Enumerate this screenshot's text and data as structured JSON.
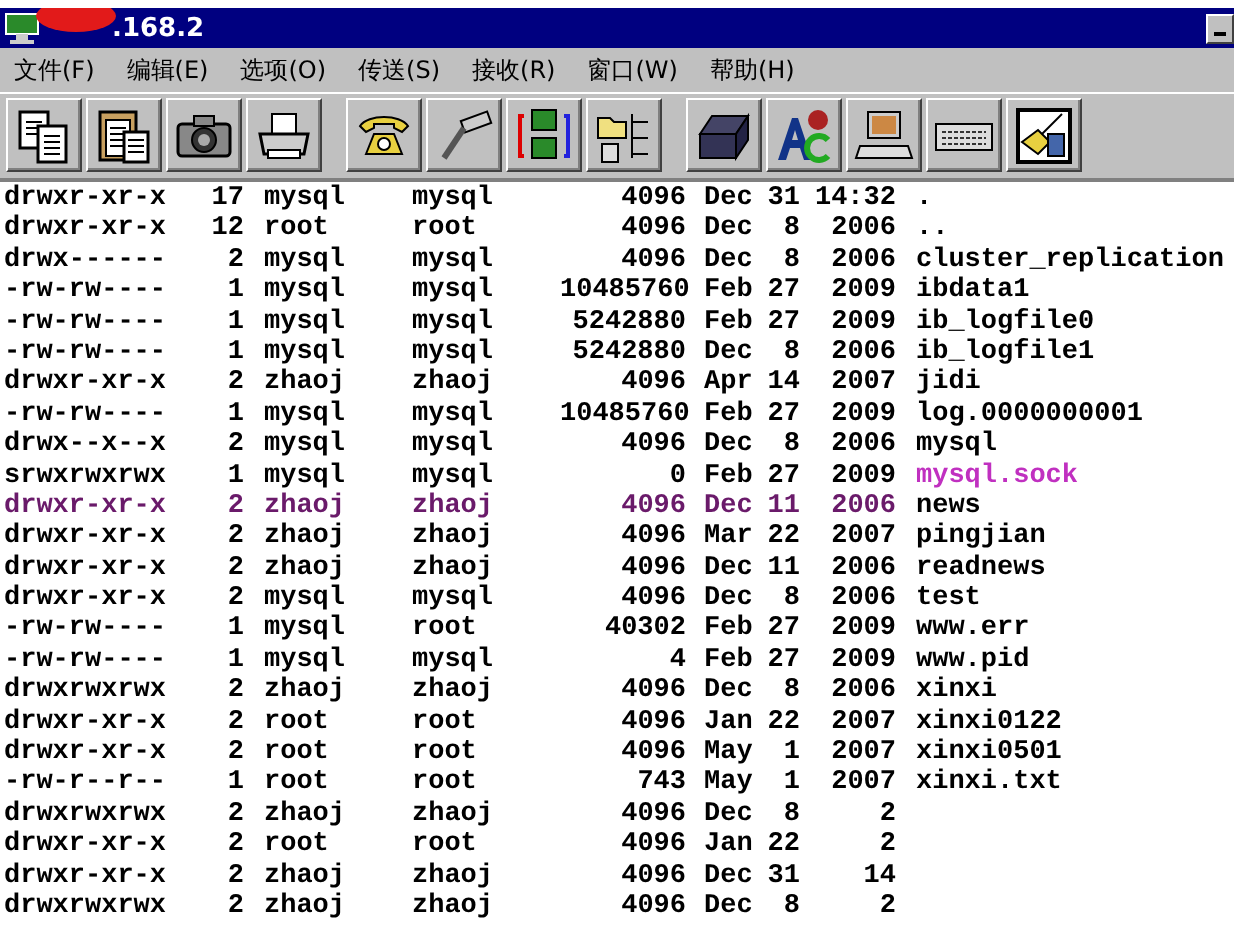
{
  "window": {
    "title": ".168.2",
    "redacted": true
  },
  "menu": [
    {
      "label": "文件(F)"
    },
    {
      "label": "编辑(E)"
    },
    {
      "label": "选项(O)"
    },
    {
      "label": "传送(S)"
    },
    {
      "label": "接收(R)"
    },
    {
      "label": "窗口(W)"
    },
    {
      "label": "帮助(H)"
    }
  ],
  "toolbar": [
    {
      "kind": "copy",
      "gap_before": false
    },
    {
      "kind": "clipboard",
      "gap_before": false
    },
    {
      "kind": "camera",
      "gap_before": false
    },
    {
      "kind": "printer",
      "gap_before": false
    },
    {
      "kind": "telephone",
      "gap_before": true
    },
    {
      "kind": "plug",
      "gap_before": false
    },
    {
      "kind": "transfer",
      "gap_before": false
    },
    {
      "kind": "folders",
      "gap_before": false
    },
    {
      "kind": "cards",
      "gap_before": true
    },
    {
      "kind": "letters",
      "gap_before": false
    },
    {
      "kind": "computer",
      "gap_before": false
    },
    {
      "kind": "keyboard",
      "gap_before": false
    },
    {
      "kind": "window",
      "gap_before": false
    }
  ],
  "listing": [
    {
      "perms": "drwxr-xr-x",
      "links": "17",
      "owner": "mysql",
      "group": "mysql",
      "size": "4096",
      "month": "Dec",
      "day": "31",
      "year": "14:32",
      "name": ".",
      "color": "#000000",
      "name_highlighted": false
    },
    {
      "perms": "drwxr-xr-x",
      "links": "12",
      "owner": "root",
      "group": "root",
      "size": "4096",
      "month": "Dec",
      "day": "8",
      "year": "2006",
      "name": "..",
      "color": "#000000",
      "name_highlighted": false
    },
    {
      "perms": "drwx------",
      "links": "2",
      "owner": "mysql",
      "group": "mysql",
      "size": "4096",
      "month": "Dec",
      "day": "8",
      "year": "2006",
      "name": "cluster_replication",
      "color": "#000000",
      "name_highlighted": false
    },
    {
      "perms": "-rw-rw----",
      "links": "1",
      "owner": "mysql",
      "group": "mysql",
      "size": "10485760",
      "month": "Feb",
      "day": "27",
      "year": "2009",
      "name": "ibdata1",
      "color": "#000000",
      "name_highlighted": false
    },
    {
      "perms": "-rw-rw----",
      "links": "1",
      "owner": "mysql",
      "group": "mysql",
      "size": "5242880",
      "month": "Feb",
      "day": "27",
      "year": "2009",
      "name": "ib_logfile0",
      "color": "#000000",
      "name_highlighted": false
    },
    {
      "perms": "-rw-rw----",
      "links": "1",
      "owner": "mysql",
      "group": "mysql",
      "size": "5242880",
      "month": "Dec",
      "day": "8",
      "year": "2006",
      "name": "ib_logfile1",
      "color": "#000000",
      "name_highlighted": false
    },
    {
      "perms": "drwxr-xr-x",
      "links": "2",
      "owner": "zhaoj",
      "group": "zhaoj",
      "size": "4096",
      "month": "Apr",
      "day": "14",
      "year": "2007",
      "name": "jidi",
      "color": "#000000",
      "name_highlighted": false
    },
    {
      "perms": "-rw-rw----",
      "links": "1",
      "owner": "mysql",
      "group": "mysql",
      "size": "10485760",
      "month": "Feb",
      "day": "27",
      "year": "2009",
      "name": "log.0000000001",
      "color": "#000000",
      "name_highlighted": false
    },
    {
      "perms": "drwx--x--x",
      "links": "2",
      "owner": "mysql",
      "group": "mysql",
      "size": "4096",
      "month": "Dec",
      "day": "8",
      "year": "2006",
      "name": "mysql",
      "color": "#000000",
      "name_highlighted": false
    },
    {
      "perms": "srwxrwxrwx",
      "links": "1",
      "owner": "mysql",
      "group": "mysql",
      "size": "0",
      "month": "Feb",
      "day": "27",
      "year": "2009",
      "name": "mysql.sock",
      "color": "#000000",
      "name_highlighted": true
    },
    {
      "perms": "drwxr-xr-x",
      "links": "2",
      "owner": "zhaoj",
      "group": "zhaoj",
      "size": "4096",
      "month": "Dec",
      "day": "11",
      "year": "2006",
      "name": "news",
      "color": "#6a1a6a",
      "name_highlighted": false
    },
    {
      "perms": "drwxr-xr-x",
      "links": "2",
      "owner": "zhaoj",
      "group": "zhaoj",
      "size": "4096",
      "month": "Mar",
      "day": "22",
      "year": "2007",
      "name": "pingjian",
      "color": "#000000",
      "name_highlighted": false
    },
    {
      "perms": "drwxr-xr-x",
      "links": "2",
      "owner": "zhaoj",
      "group": "zhaoj",
      "size": "4096",
      "month": "Dec",
      "day": "11",
      "year": "2006",
      "name": "readnews",
      "color": "#000000",
      "name_highlighted": false
    },
    {
      "perms": "drwxr-xr-x",
      "links": "2",
      "owner": "mysql",
      "group": "mysql",
      "size": "4096",
      "month": "Dec",
      "day": "8",
      "year": "2006",
      "name": "test",
      "color": "#000000",
      "name_highlighted": false
    },
    {
      "perms": "-rw-rw----",
      "links": "1",
      "owner": "mysql",
      "group": "root",
      "size": "40302",
      "month": "Feb",
      "day": "27",
      "year": "2009",
      "name": "www.err",
      "color": "#000000",
      "name_highlighted": false
    },
    {
      "perms": "-rw-rw----",
      "links": "1",
      "owner": "mysql",
      "group": "mysql",
      "size": "4",
      "month": "Feb",
      "day": "27",
      "year": "2009",
      "name": "www.pid",
      "color": "#000000",
      "name_highlighted": false
    },
    {
      "perms": "drwxrwxrwx",
      "links": "2",
      "owner": "zhaoj",
      "group": "zhaoj",
      "size": "4096",
      "month": "Dec",
      "day": "8",
      "year": "2006",
      "name": "xinxi",
      "color": "#000000",
      "name_highlighted": false
    },
    {
      "perms": "drwxr-xr-x",
      "links": "2",
      "owner": "root",
      "group": "root",
      "size": "4096",
      "month": "Jan",
      "day": "22",
      "year": "2007",
      "name": "xinxi0122",
      "color": "#000000",
      "name_highlighted": false
    },
    {
      "perms": "drwxr-xr-x",
      "links": "2",
      "owner": "root",
      "group": "root",
      "size": "4096",
      "month": "May",
      "day": "1",
      "year": "2007",
      "name": "xinxi0501",
      "color": "#000000",
      "name_highlighted": false
    },
    {
      "perms": "-rw-r--r--",
      "links": "1",
      "owner": "root",
      "group": "root",
      "size": "743",
      "month": "May",
      "day": "1",
      "year": "2007",
      "name": "xinxi.txt",
      "color": "#000000",
      "name_highlighted": false
    },
    {
      "perms": "drwxrwxrwx",
      "links": "2",
      "owner": "zhaoj",
      "group": "zhaoj",
      "size": "4096",
      "month": "Dec",
      "day": "8",
      "year": "2",
      "color": "#000000"
    },
    {
      "perms": "drwxr-xr-x",
      "links": "2",
      "owner": "root",
      "group": "root",
      "size": "4096",
      "month": "Jan",
      "day": "22",
      "year": "2",
      "color": "#000000"
    },
    {
      "perms": "drwxr-xr-x",
      "links": "2",
      "owner": "zhaoj",
      "group": "zhaoj",
      "size": "4096",
      "month": "Dec",
      "day": "31",
      "year": "14",
      "color": "#000000"
    },
    {
      "perms": "drwxrwxrwx",
      "links": "2",
      "owner": "zhaoj",
      "group": "zhaoj",
      "size": "4096",
      "month": "Dec",
      "day": "8",
      "year": "2",
      "color": "#000000"
    }
  ]
}
